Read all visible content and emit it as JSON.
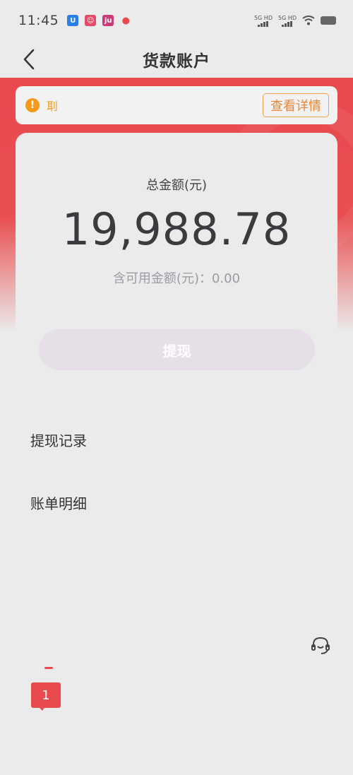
{
  "status_bar": {
    "time": "11:45",
    "network1": "5G HD",
    "network2": "5G HD",
    "icons": [
      "u-app-icon",
      "chat-app-icon",
      "ju-app-icon",
      "location-icon",
      "wifi-icon",
      "battery-icon"
    ]
  },
  "header": {
    "title": "货款账户",
    "back_icon": "chevron-left-icon"
  },
  "notice": {
    "icon": "alert-icon",
    "text": "刵",
    "detail_label": "查看详情"
  },
  "balance": {
    "total_label": "总金额(元)",
    "total_amount": "19,988.78",
    "available_text": "含可用金额(元)：0.00"
  },
  "actions": {
    "withdraw_label": "提现"
  },
  "menu": {
    "items": [
      {
        "label": "提现记录"
      },
      {
        "label": "账单明细"
      }
    ]
  },
  "floating": {
    "support_icon": "headset-icon",
    "message_count": "1"
  },
  "colors": {
    "brand_red": "#e84a4e",
    "notice_orange": "#f39a1c",
    "detail_orange": "#e8873a",
    "background": "#ebebeb"
  }
}
